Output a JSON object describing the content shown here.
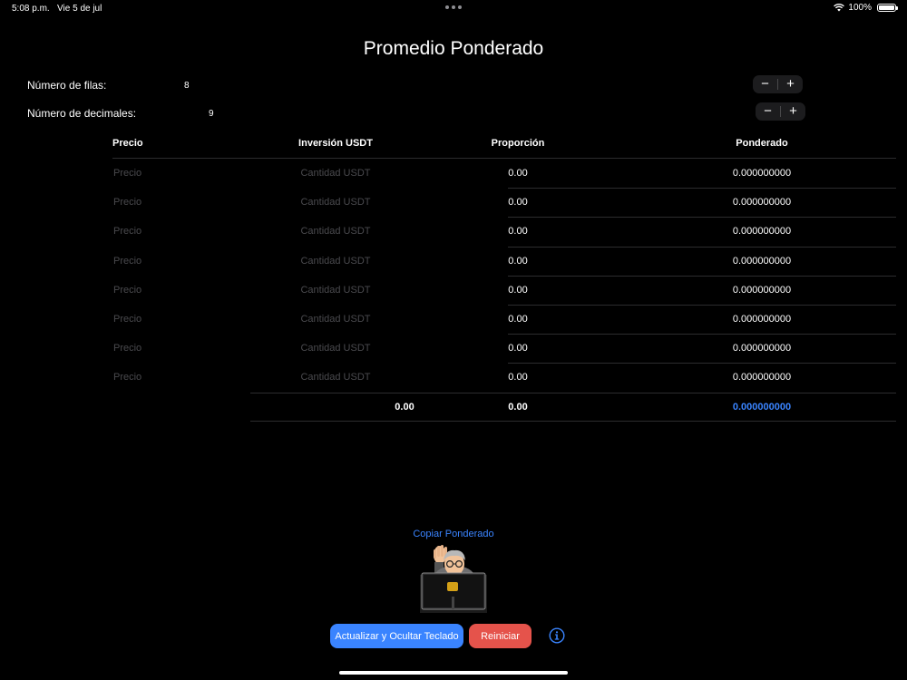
{
  "status": {
    "time": "5:08 p.m.",
    "date": "Vie 5 de jul",
    "battery": "100%"
  },
  "title": "Promedio Ponderado",
  "settings": {
    "rows_label": "Número de filas:",
    "rows_value": "8",
    "decimals_label": "Número de decimales:",
    "decimals_value": "9",
    "minus": "−",
    "plus": "+"
  },
  "table": {
    "headers": [
      "Precio",
      "Inversión USDT",
      "Proporción",
      "Ponderado"
    ],
    "rows": [
      {
        "price": "Precio",
        "amount": "Cantidad USDT",
        "proportion": "0.00",
        "weighted": "0.000000000"
      },
      {
        "price": "Precio",
        "amount": "Cantidad USDT",
        "proportion": "0.00",
        "weighted": "0.000000000"
      },
      {
        "price": "Precio",
        "amount": "Cantidad USDT",
        "proportion": "0.00",
        "weighted": "0.000000000"
      },
      {
        "price": "Precio",
        "amount": "Cantidad USDT",
        "proportion": "0.00",
        "weighted": "0.000000000"
      },
      {
        "price": "Precio",
        "amount": "Cantidad USDT",
        "proportion": "0.00",
        "weighted": "0.000000000"
      },
      {
        "price": "Precio",
        "amount": "Cantidad USDT",
        "proportion": "0.00",
        "weighted": "0.000000000"
      },
      {
        "price": "Precio",
        "amount": "Cantidad USDT",
        "proportion": "0.00",
        "weighted": "0.000000000"
      },
      {
        "price": "Precio",
        "amount": "Cantidad USDT",
        "proportion": "0.00",
        "weighted": "0.000000000"
      }
    ],
    "totals": {
      "amount": "0.00",
      "proportion": "0.00",
      "weighted": "0.000000000"
    }
  },
  "copy_label": "Copiar Ponderado",
  "buttons": {
    "update": "Actualizar y Ocultar Teclado",
    "reset": "Reiniciar"
  },
  "colors": {
    "accent": "#3a84ff",
    "danger": "#e5534b",
    "background": "#000000"
  }
}
